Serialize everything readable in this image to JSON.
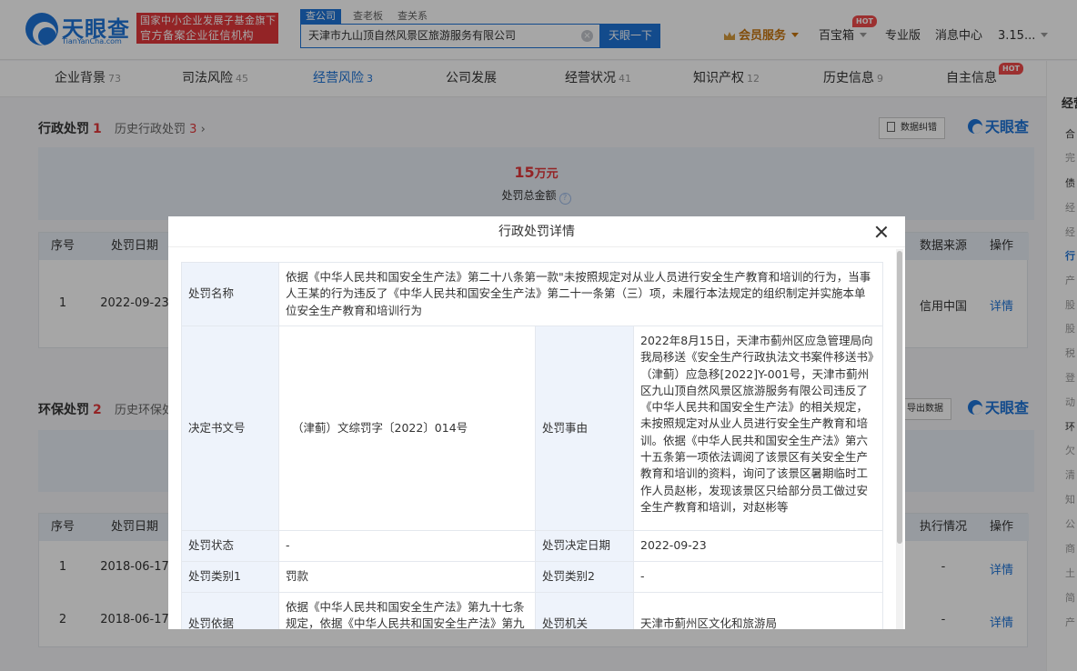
{
  "header": {
    "logo_name": "天眼查",
    "logo_url": "TianYanCha.com",
    "gov_badge_line1": "国家中小企业发展子基金旗下",
    "gov_badge_line2": "官方备案企业征信机构",
    "search_tabs": [
      "查公司",
      "查老板",
      "查关系"
    ],
    "search_value": "天津市九山顶自然风景区旅游服务有限公司",
    "search_button": "天眼一下",
    "nav": {
      "vip": "会员服务",
      "baibaoxiang": "百宝箱",
      "pro": "专业版",
      "messages": "消息中心",
      "user": "3.15...",
      "hot": "HOT"
    }
  },
  "tabs": [
    {
      "label": "企业背景",
      "count": "73"
    },
    {
      "label": "司法风险",
      "count": "45"
    },
    {
      "label": "经营风险",
      "count": "3"
    },
    {
      "label": "公司发展",
      "count": ""
    },
    {
      "label": "经营状况",
      "count": "41"
    },
    {
      "label": "知识产权",
      "count": "12"
    },
    {
      "label": "历史信息",
      "count": "9"
    },
    {
      "label": "自主信息",
      "count": ""
    }
  ],
  "rightbar": {
    "title": "经营",
    "items": [
      "合",
      "完",
      "债",
      "经",
      "经",
      "行",
      "产",
      "股",
      "股",
      "税",
      "登",
      "动",
      "环",
      "欠",
      "清",
      "知",
      "公",
      "商",
      "土",
      "简",
      "产"
    ]
  },
  "section_admin": {
    "title": "行政处罚",
    "count": "1",
    "history_label": "历史行政处罚",
    "history_count": "3",
    "button": "数据纠错",
    "watermark": "天眼查",
    "total_value": "15",
    "total_unit": "万元",
    "total_label": "处罚总金额",
    "columns": [
      "序号",
      "处罚日期",
      "数据来源",
      "操作"
    ],
    "rows": [
      {
        "index": "1",
        "date": "2022-09-23",
        "source": "信用中国",
        "action": "详情"
      }
    ]
  },
  "section_env": {
    "title": "环保处罚",
    "count": "2",
    "history_label": "历史环保处罚",
    "button": "导出数据",
    "watermark": "天眼查",
    "columns": [
      "序号",
      "处罚日期",
      "执行情况",
      "操作"
    ],
    "rows": [
      {
        "index": "1",
        "date": "2018-06-17",
        "status": "-",
        "action": "详情"
      },
      {
        "index": "2",
        "date": "2018-06-17",
        "status": "-",
        "action": "详情"
      }
    ]
  },
  "modal": {
    "title": "行政处罚详情",
    "name_label": "处罚名称",
    "name_value": "依据《中华人民共和国安全生产法》第二十八条第一款\"未按照规定对从业人员进行安全生产教育和培训的行为，当事人王某的行为违反了《中华人民共和国安全生产法》第二十一条第（三）项，未履行本法规定的组织制定并实施本单位安全生产教育和培训行为",
    "doc_no_label": "决定书文号",
    "doc_no_value": "（津蓟）文综罚字〔2022〕014号",
    "reason_label": "处罚事由",
    "reason_value": "2022年8月15日，天津市蓟州区应急管理局向我局移送《安全生产行政执法文书案件移送书》（津蓟）应急移[2022]Y-001号，天津市蓟州区九山顶自然风景区旅游服务有限公司违反了《中华人民共和国安全生产法》的相关规定，未按照规定对从业人员进行安全生产教育和培训。依据《中华人民共和国安全生产法》第六十五条第一项依法调阅了该景区有关安全生产教育和培训的资料，询问了该景区暑期临时工作人员赵彬，发现该景区只给部分员工做过安全生产教育和培训，对赵彬等",
    "status_label": "处罚状态",
    "status_value": "-",
    "decision_date_label": "处罚决定日期",
    "decision_date_value": "2022-09-23",
    "type1_label": "处罚类别1",
    "type1_value": "罚款",
    "type2_label": "处罚类别2",
    "type2_value": "-",
    "basis_label": "处罚依据",
    "basis_value": "依据《中华人民共和国安全生产法》第九十七条规定，依据《中华人民共和国安全生产法》第九",
    "authority_label": "处罚机关",
    "authority_value": "天津市蓟州区文化和旅游局"
  }
}
